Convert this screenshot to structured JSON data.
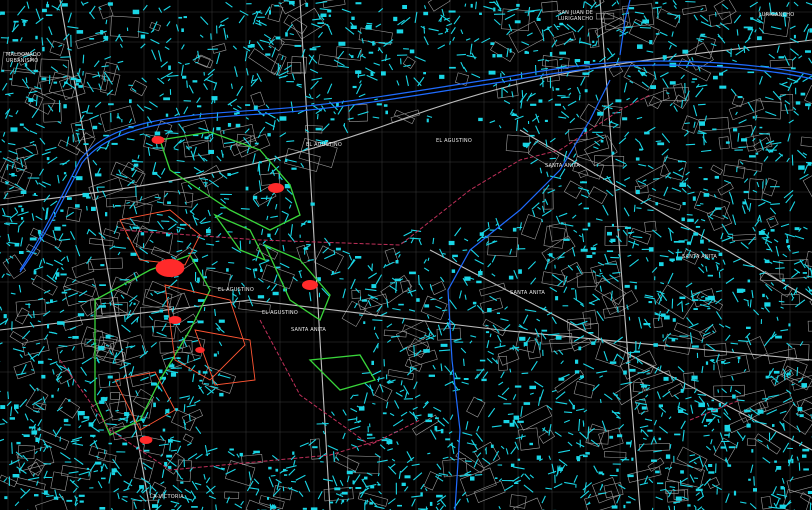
{
  "map": {
    "title": "",
    "colors": {
      "background": "#000000",
      "grid": "#3a3a3a",
      "streets": "#9a9a9a",
      "lots": "#19d6e6",
      "river": "#1f6bff",
      "boundary": "#c0305a",
      "green_zone": "#39d43a",
      "red_zone": "#ff2a2a"
    },
    "labels": {
      "top_left_area": "MALDONADO\nURBANISMO",
      "top_center": "SAN JUAN DE\nLURIGANCHO",
      "top_right": "LURIGANCHO",
      "el_agustino_1": "EL AGUSTINO",
      "el_agustino_2": "EL AGUSTINO",
      "el_agustino_3": "EL AGUSTINO",
      "el_agustino_4": "EL AGUSTINO",
      "santa_anita_1": "SANTA ANITA",
      "santa_anita_2": "SANTA ANITA",
      "santa_anita_3": "SANTA ANITA",
      "santa_anita_4": "SANTA ANITA",
      "la_victoria": "LA VICTORIA"
    }
  }
}
